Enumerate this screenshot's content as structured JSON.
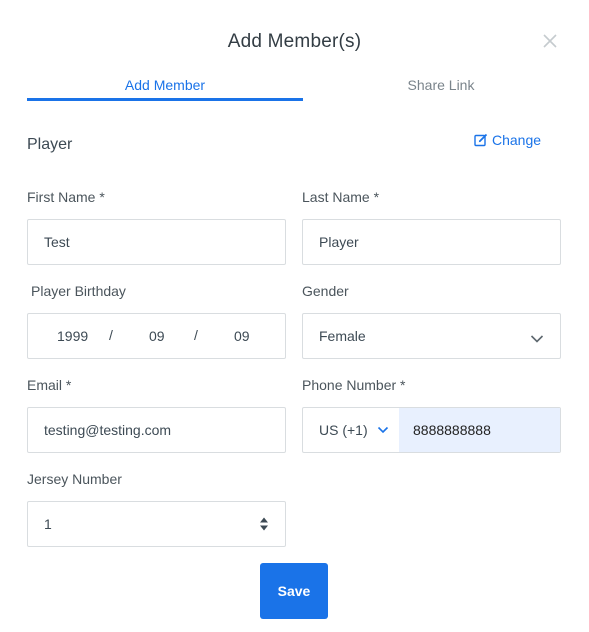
{
  "modal": {
    "title": "Add Member(s)"
  },
  "tabs": [
    {
      "label": "Add Member",
      "active": true
    },
    {
      "label": "Share Link",
      "active": false
    }
  ],
  "section": {
    "label": "Player",
    "change_label": "Change"
  },
  "form": {
    "first_name": {
      "label": "First Name *",
      "value": "Test"
    },
    "last_name": {
      "label": "Last Name *",
      "value": "Player"
    },
    "birthday": {
      "label": "Player Birthday",
      "year": "1999",
      "month": "09",
      "day": "09",
      "separator": "/"
    },
    "gender": {
      "label": "Gender",
      "value": "Female"
    },
    "email": {
      "label": "Email *",
      "value": "testing@testing.com"
    },
    "phone": {
      "label": "Phone Number *",
      "country_code": "US (+1)",
      "value": "8888888888"
    },
    "jersey": {
      "label": "Jersey Number",
      "value": "1"
    }
  },
  "actions": {
    "save_label": "Save"
  },
  "colors": {
    "accent": "#1a73e8",
    "autofill": "#e8f0fe",
    "border": "#d9dde0"
  },
  "icons": [
    "close-icon",
    "edit-icon",
    "chevron-down-icon",
    "spinner-arrows-icon"
  ]
}
